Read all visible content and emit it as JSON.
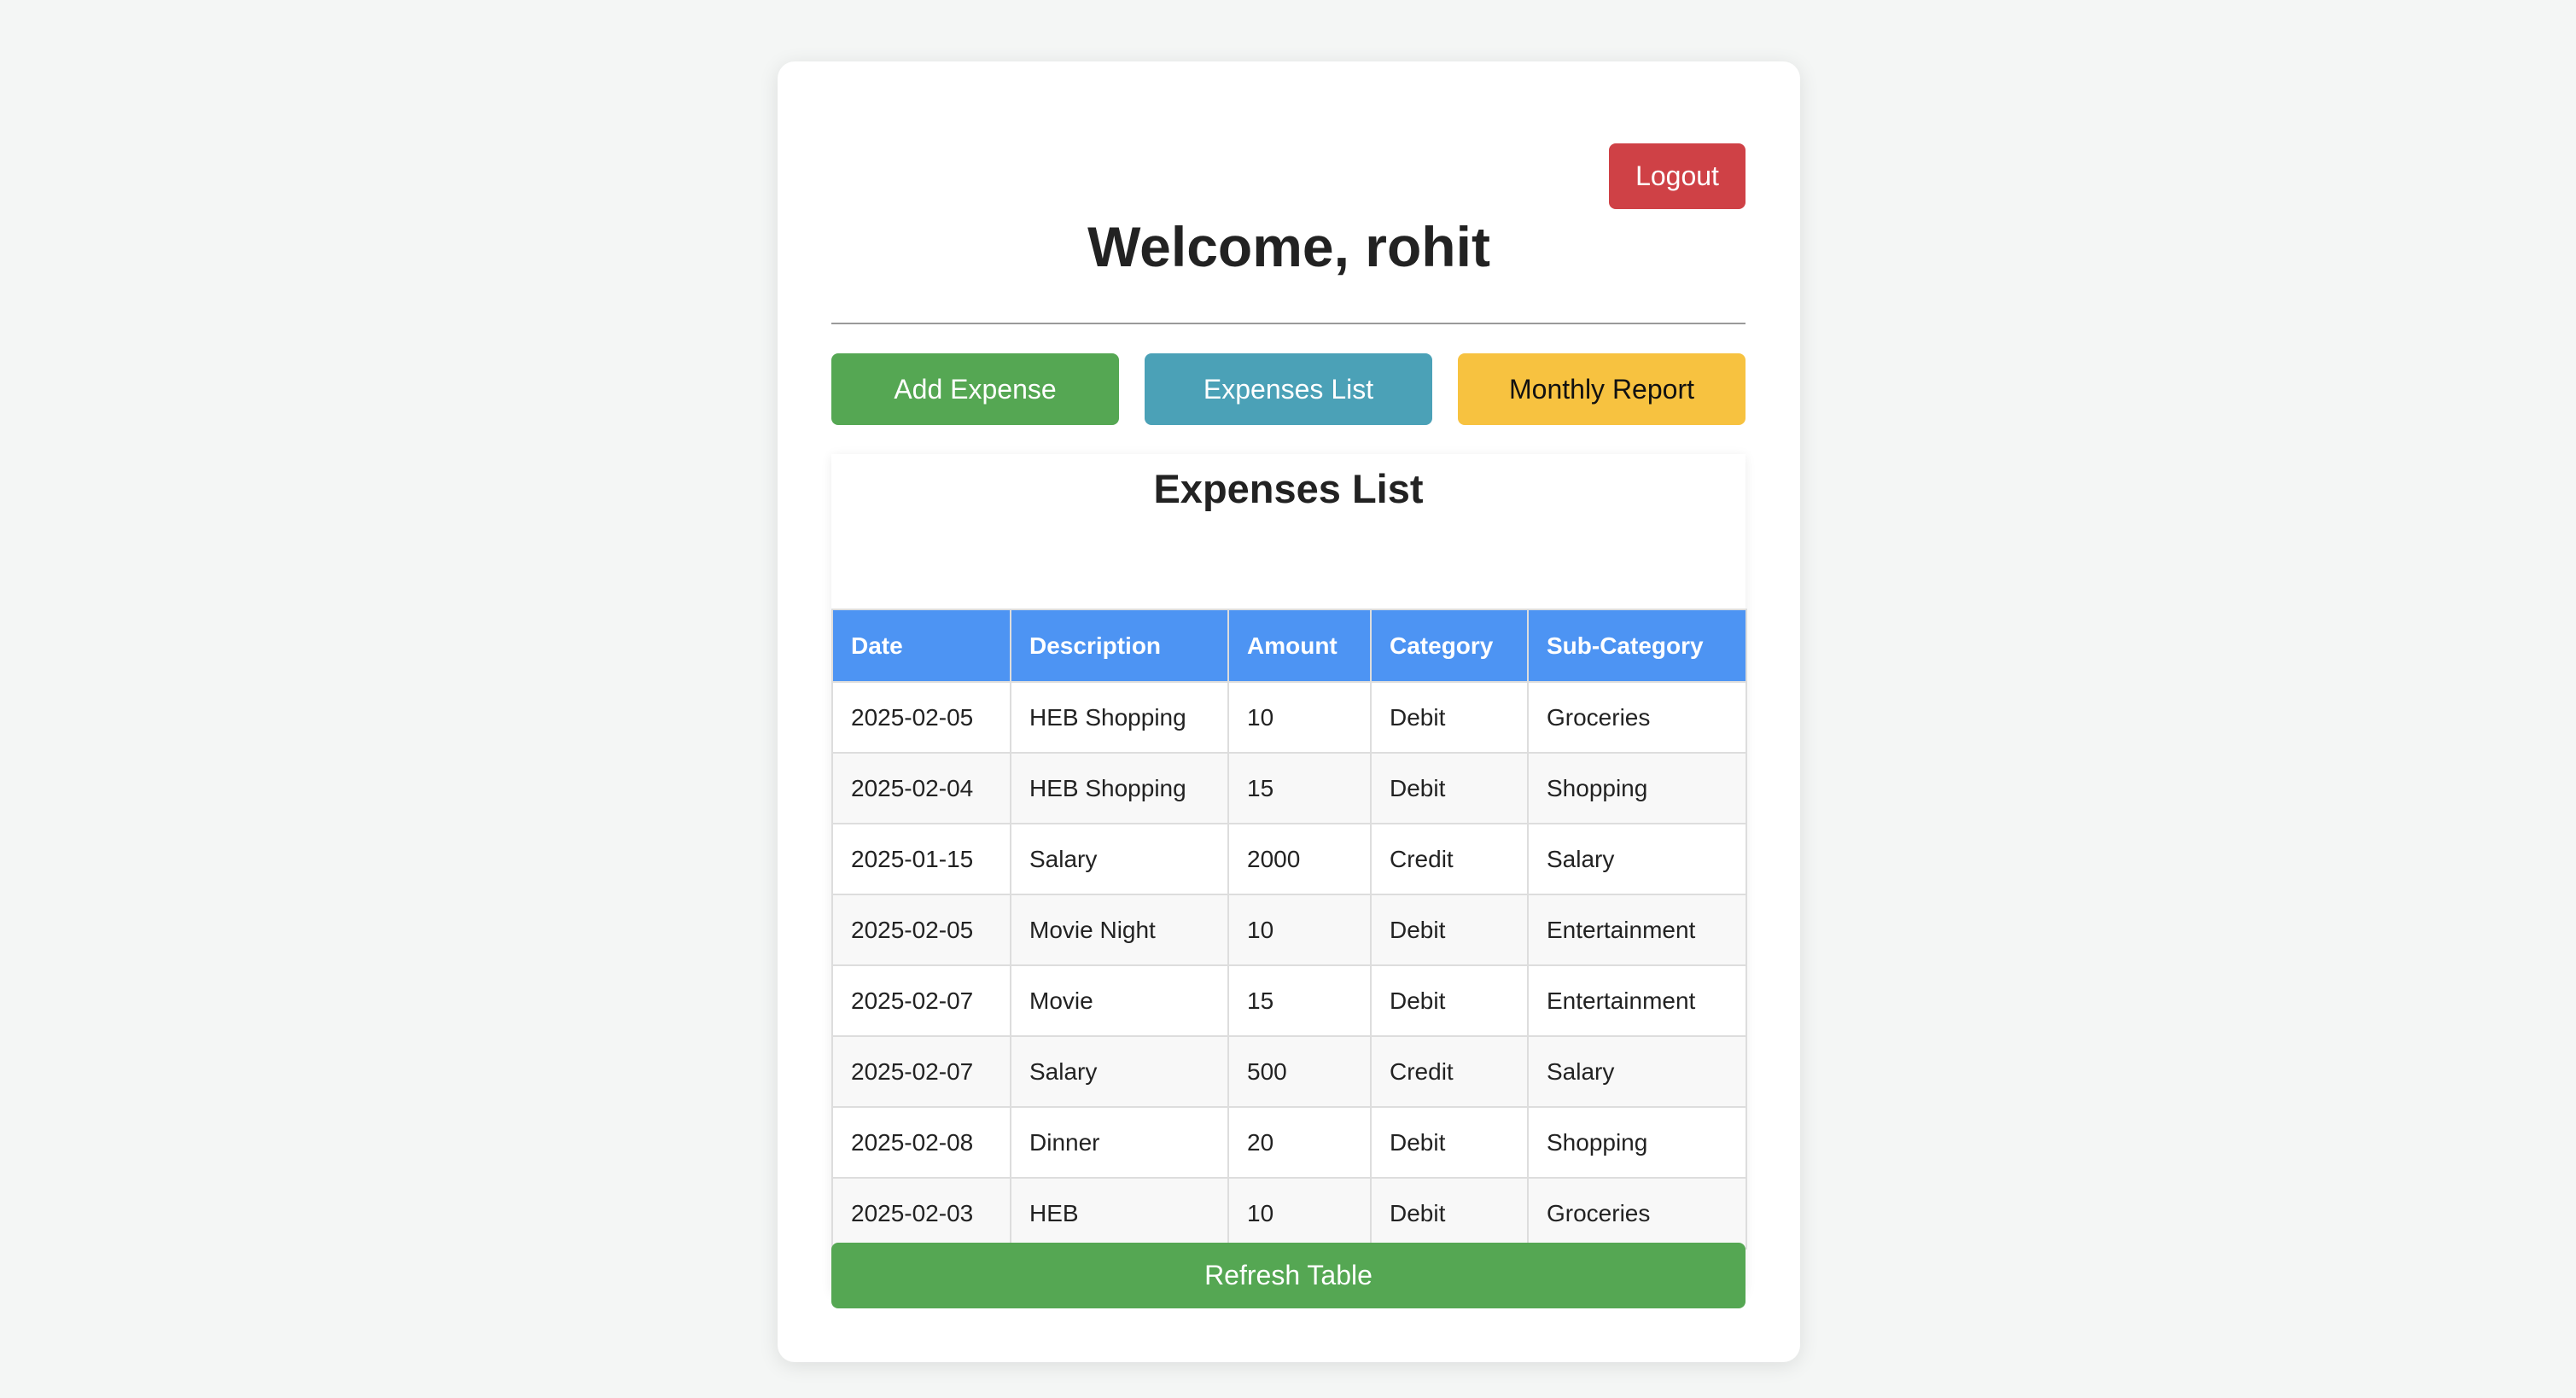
{
  "header": {
    "logout_label": "Logout",
    "welcome_text": "Welcome, rohit"
  },
  "nav": {
    "add_expense_label": "Add Expense",
    "expenses_list_label": "Expenses List",
    "monthly_report_label": "Monthly Report"
  },
  "expenses": {
    "title": "Expenses List",
    "columns": [
      "Date",
      "Description",
      "Amount",
      "Category",
      "Sub-Category"
    ],
    "rows": [
      [
        "2025-02-05",
        "HEB Shopping",
        "10",
        "Debit",
        "Groceries"
      ],
      [
        "2025-02-04",
        "HEB Shopping",
        "15",
        "Debit",
        "Shopping"
      ],
      [
        "2025-01-15",
        "Salary",
        "2000",
        "Credit",
        "Salary"
      ],
      [
        "2025-02-05",
        "Movie Night",
        "10",
        "Debit",
        "Entertainment"
      ],
      [
        "2025-02-07",
        "Movie",
        "15",
        "Debit",
        "Entertainment"
      ],
      [
        "2025-02-07",
        "Salary",
        "500",
        "Credit",
        "Salary"
      ],
      [
        "2025-02-08",
        "Dinner",
        "20",
        "Debit",
        "Shopping"
      ],
      [
        "2025-02-03",
        "HEB",
        "10",
        "Debit",
        "Groceries"
      ]
    ],
    "refresh_label": "Refresh Table"
  },
  "colors": {
    "logout": "#cf4146",
    "add_expense": "#55a753",
    "expenses_list": "#4ba1b7",
    "monthly_report": "#f7c240",
    "table_header": "#4d94f3",
    "refresh": "#55a753"
  }
}
